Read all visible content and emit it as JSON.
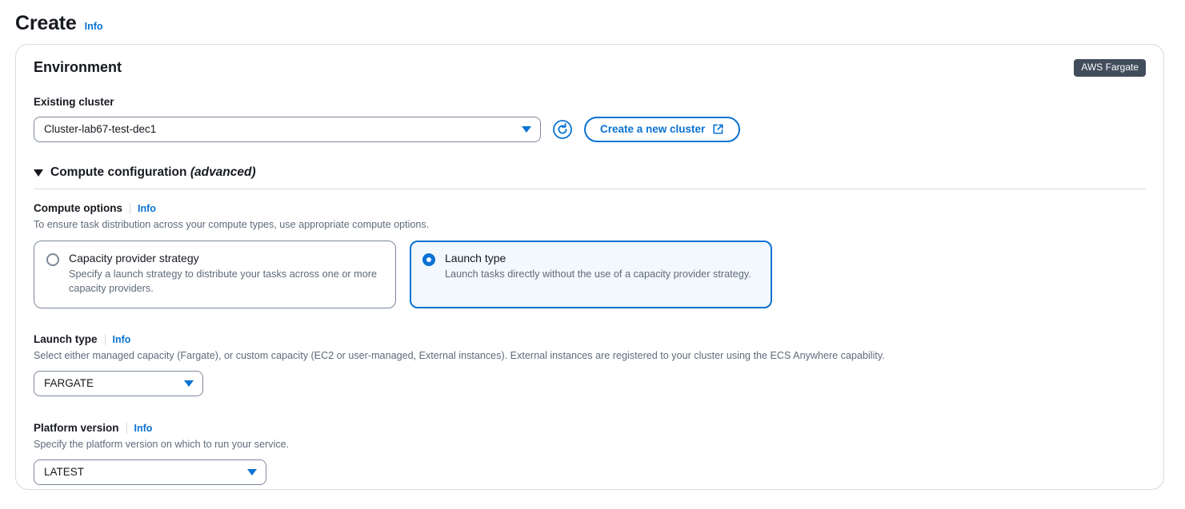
{
  "page": {
    "title": "Create",
    "info_label": "Info"
  },
  "environment": {
    "section_title": "Environment",
    "badge": "AWS Fargate",
    "existing_cluster": {
      "label": "Existing cluster",
      "value": "Cluster-lab67-test-dec1",
      "refresh_icon": "refresh-icon"
    },
    "create_cluster_button": {
      "label": "Create a new cluster",
      "icon": "external-link-icon"
    },
    "compute_configuration": {
      "title": "Compute configuration",
      "title_suffix": "(advanced)",
      "expanded": true,
      "compute_options": {
        "label": "Compute options",
        "info_label": "Info",
        "description": "To ensure task distribution across your compute types, use appropriate compute options.",
        "tiles": [
          {
            "title": "Capacity provider strategy",
            "description": "Specify a launch strategy to distribute your tasks across one or more capacity providers.",
            "selected": false
          },
          {
            "title": "Launch type",
            "description": "Launch tasks directly without the use of a capacity provider strategy.",
            "selected": true
          }
        ]
      },
      "launch_type": {
        "label": "Launch type",
        "info_label": "Info",
        "description": "Select either managed capacity (Fargate), or custom capacity (EC2 or user-managed, External instances). External instances are registered to your cluster using the ECS Anywhere capability.",
        "value": "FARGATE"
      },
      "platform_version": {
        "label": "Platform version",
        "info_label": "Info",
        "description": "Specify the platform version on which to run your service.",
        "value": "LATEST"
      }
    }
  },
  "colors": {
    "accent": "#0972d3",
    "badge_bg": "#414d5c",
    "border": "#d5dbdb",
    "input_border": "#7d8998",
    "selected_bg": "#f2f8fd",
    "text": "#16191f",
    "muted_text": "#5f6b7a"
  }
}
